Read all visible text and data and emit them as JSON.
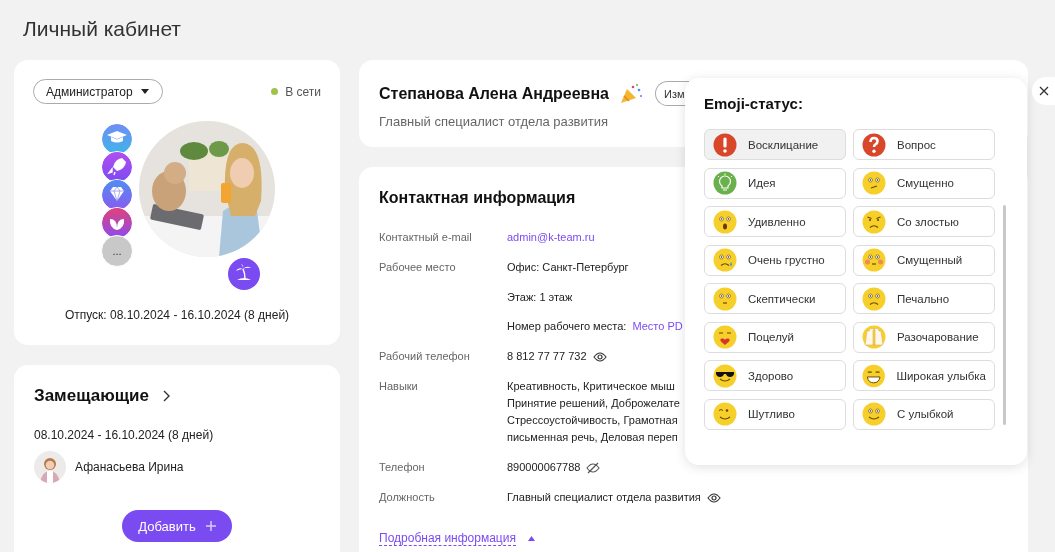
{
  "page_title": "Личный кабинет",
  "profile_card": {
    "role": "Администратор",
    "status": "В сети",
    "more_badge": "...",
    "vacation": "Отпуск:  08.10.2024 - 16.10.2024 (8 дней)"
  },
  "substitutes": {
    "title": "Замещающие",
    "period": "08.10.2024 - 16.10.2024 (8 дней)",
    "people": [
      {
        "name": "Афанасьева Ирина"
      }
    ],
    "add_button": "Добавить"
  },
  "header": {
    "name": "Степанова Алена Андреевна",
    "position": "Главный специалист отдела развития",
    "button": "Изм"
  },
  "contact": {
    "title": "Контактная информация",
    "rows": [
      {
        "label": "Контактный e-mail",
        "lines": [
          {
            "link": "admin@k-team.ru"
          }
        ]
      },
      {
        "label": "Рабочее место",
        "lines": [
          {
            "text": "Офис: Санкт-Петербург"
          },
          {
            "text": "Этаж: 1 этаж"
          },
          {
            "text": "Номер рабочего места:",
            "link": "Место PD"
          }
        ]
      },
      {
        "label": "Рабочий телефон",
        "lines": [
          {
            "text": "8 812 77 77 732"
          }
        ],
        "number_visible": true
      },
      {
        "label": "Навыки",
        "paragraph": [
          "Креативность, Критическое мыш",
          "Принятие решений, Доброжелате",
          "Стрессоустойчивость, Грамотная",
          "письменная речь, Деловая переп"
        ]
      },
      {
        "label": "Телефон",
        "lines": [
          {
            "text": "890000067788"
          }
        ],
        "number_visible": false
      },
      {
        "label": "Должность",
        "lines": [
          {
            "text": "Главный специалист отдела развития"
          }
        ],
        "number_visible": true
      }
    ],
    "more_link": "Подробная информация"
  },
  "emoji_popover": {
    "title": "Emoji-статус:",
    "options": [
      {
        "label": "Восклицание",
        "selected": true
      },
      {
        "label": "Вопрос",
        "selected": false
      },
      {
        "label": "Идея",
        "selected": false
      },
      {
        "label": "Смущенно",
        "selected": false
      },
      {
        "label": "Удивленно",
        "selected": false
      },
      {
        "label": "Со злостью",
        "selected": false
      },
      {
        "label": "Очень грустно",
        "selected": false
      },
      {
        "label": "Смущенный",
        "selected": false
      },
      {
        "label": "Скептически",
        "selected": false
      },
      {
        "label": "Печально",
        "selected": false
      },
      {
        "label": "Поцелуй",
        "selected": false
      },
      {
        "label": "Разочарование",
        "selected": false
      },
      {
        "label": "Здорово",
        "selected": false
      },
      {
        "label": "Широкая улыбка",
        "selected": false
      },
      {
        "label": "Шутливо",
        "selected": false
      },
      {
        "label": "С улыбкой",
        "selected": false
      }
    ]
  }
}
